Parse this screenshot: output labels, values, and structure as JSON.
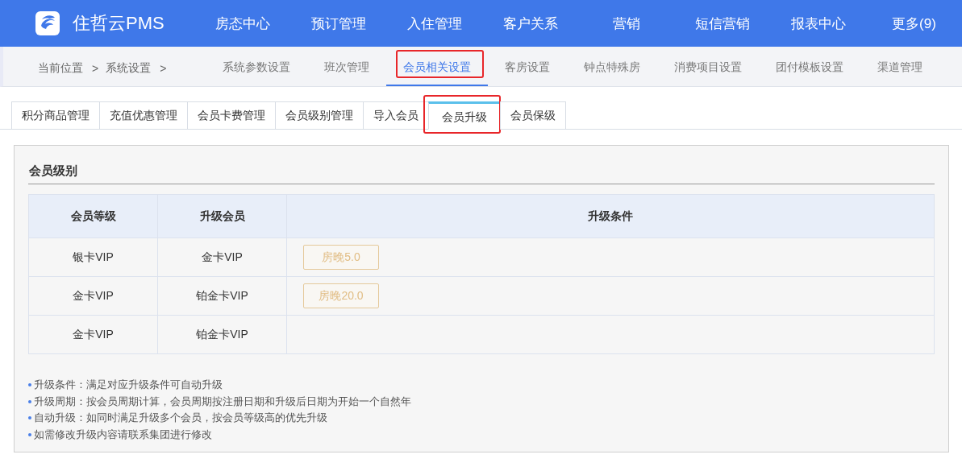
{
  "app": {
    "name": "住哲云PMS"
  },
  "top_nav": [
    {
      "label": "房态中心"
    },
    {
      "label": "预订管理"
    },
    {
      "label": "入住管理"
    },
    {
      "label": "客户关系"
    },
    {
      "label": "营销"
    },
    {
      "label": "短信营销"
    },
    {
      "label": "报表中心"
    },
    {
      "label": "更多(9)"
    }
  ],
  "breadcrumb": [
    {
      "kind": "crumb",
      "text": "当前位置"
    },
    {
      "kind": "separator",
      "text": ">"
    },
    {
      "kind": "crumb",
      "text": "系统设置"
    },
    {
      "kind": "separator",
      "text": ">"
    }
  ],
  "settings_tabs": [
    {
      "label": "系统参数设置",
      "selected": false,
      "highlighted": false
    },
    {
      "label": "班次管理",
      "selected": false,
      "highlighted": false
    },
    {
      "label": "会员相关设置",
      "selected": true,
      "highlighted": true
    },
    {
      "label": "客房设置",
      "selected": false,
      "highlighted": false
    },
    {
      "label": "钟点特殊房",
      "selected": false,
      "highlighted": false
    },
    {
      "label": "消费项目设置",
      "selected": false,
      "highlighted": false
    },
    {
      "label": "团付模板设置",
      "selected": false,
      "highlighted": false
    },
    {
      "label": "渠道管理",
      "selected": false,
      "highlighted": false
    }
  ],
  "member_tabs": [
    {
      "label": "积分商品管理",
      "selected": false,
      "highlighted": false
    },
    {
      "label": "充值优惠管理",
      "selected": false,
      "highlighted": false
    },
    {
      "label": "会员卡费管理",
      "selected": false,
      "highlighted": false
    },
    {
      "label": "会员级别管理",
      "selected": false,
      "highlighted": false
    },
    {
      "label": "导入会员",
      "selected": false,
      "highlighted": false
    },
    {
      "label": "会员升级",
      "selected": true,
      "highlighted": true
    },
    {
      "label": "会员保级",
      "selected": false,
      "highlighted": false
    }
  ],
  "panel": {
    "title": "会员级别",
    "table": {
      "columns": [
        "会员等级",
        "升级会员",
        "升级条件"
      ],
      "rows": [
        {
          "level": "银卡VIP",
          "upgrade_to": "金卡VIP",
          "condition": "房晚5.0"
        },
        {
          "level": "金卡VIP",
          "upgrade_to": "铂金卡VIP",
          "condition": "房晚20.0"
        },
        {
          "level": "金卡VIP",
          "upgrade_to": "铂金卡VIP"
        }
      ]
    },
    "notes": [
      "升级条件：满足对应升级条件可自动升级",
      "升级周期：按会员周期计算，会员周期按注册日期和升级后日期为开始一个自然年",
      "自动升级：如同时满足升级多个会员，按会员等级高的优先升级",
      "如需修改升级内容请联系集团进行修改"
    ]
  }
}
